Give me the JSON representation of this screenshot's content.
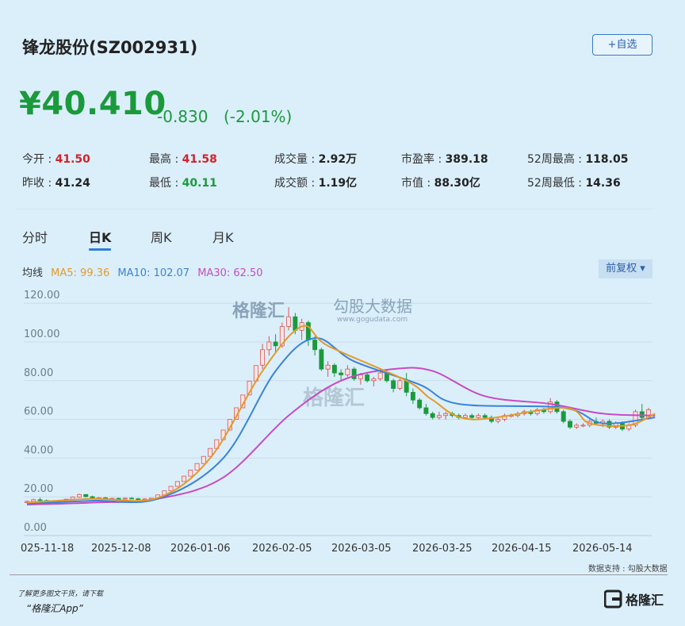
{
  "stock": {
    "title": "锋龙股份(SZ002931)",
    "fav_label": "+自选",
    "price": "¥40.410",
    "change": "-0.830",
    "change_pct": "(-2.01%)"
  },
  "stats": [
    {
      "label": "今开 : ",
      "value": "41.50",
      "color": "red"
    },
    {
      "label": "最高 : ",
      "value": "41.58",
      "color": "red"
    },
    {
      "label": "成交量 : ",
      "value": "2.92万",
      "color": "dark"
    },
    {
      "label": "市盈率 : ",
      "value": "389.18",
      "color": "dark"
    },
    {
      "label": "52周最高 : ",
      "value": "118.05",
      "color": "dark"
    },
    {
      "label": "昨收 : ",
      "value": "41.24",
      "color": "dark"
    },
    {
      "label": "最低 : ",
      "value": "40.11",
      "color": "green"
    },
    {
      "label": "成交额 : ",
      "value": "1.19亿",
      "color": "dark"
    },
    {
      "label": "市值 : ",
      "value": "88.30亿",
      "color": "dark"
    },
    {
      "label": "52周最低 : ",
      "value": "14.36",
      "color": "dark"
    }
  ],
  "tabs": [
    "分时",
    "日K",
    "周K",
    "月K"
  ],
  "active_tab": "日K",
  "ma": {
    "label": "均线",
    "ma5": "MA5: 99.36",
    "ma10": "MA10: 102.07",
    "ma30": "MA30: 62.50",
    "colors": {
      "ma5": "#e39a2a",
      "ma10": "#3b82d9",
      "ma30": "#c64bc2"
    }
  },
  "adjust_label": "前复权 ▾",
  "watermark": {
    "brand1": "格隆汇",
    "brand2": "勾股大数据",
    "url": "www.gogudata.com",
    "center": "格隆汇"
  },
  "chart_data": {
    "type": "candlestick",
    "y_ticks": [
      "120.00",
      "100.00",
      "80.00",
      "60.00",
      "40.00",
      "20.00",
      "0.00"
    ],
    "ylim": [
      0,
      125
    ],
    "x_ticks": [
      "025-11-18",
      "2025-12-08",
      "2026-01-06",
      "2026-02-05",
      "2026-03-05",
      "2026-03-25",
      "2026-04-15",
      "2026-05-14"
    ],
    "colors": {
      "up": "#d9534f",
      "down": "#1b9a3c"
    },
    "candles": [
      [
        17,
        18.2,
        16.6,
        17.6
      ],
      [
        17.6,
        19,
        17.2,
        18.5
      ],
      [
        18.5,
        19.6,
        17.8,
        18.1
      ],
      [
        18.1,
        18.6,
        17.2,
        17.5
      ],
      [
        17.5,
        18,
        16.8,
        17.2
      ],
      [
        17.2,
        18,
        16.9,
        17.7
      ],
      [
        17.7,
        19,
        17.4,
        18.8
      ],
      [
        18.8,
        20.2,
        18.4,
        19.9
      ],
      [
        19.9,
        21.6,
        19.5,
        21.2
      ],
      [
        21.2,
        21.4,
        19.6,
        20.1
      ],
      [
        20.1,
        20.6,
        19.1,
        19.4
      ],
      [
        19.4,
        20,
        18.8,
        19.5
      ],
      [
        19.5,
        20,
        18.6,
        18.9
      ],
      [
        18.9,
        19.5,
        18.4,
        19.2
      ],
      [
        19.2,
        19.6,
        18.7,
        18.9
      ],
      [
        18.9,
        19.6,
        18.5,
        19.3
      ],
      [
        19.3,
        19.8,
        18.8,
        19.0
      ],
      [
        19.0,
        19.4,
        18.4,
        18.7
      ],
      [
        18.7,
        19.2,
        18.3,
        18.9
      ],
      [
        18.9,
        19.5,
        18.6,
        19.3
      ],
      [
        19.3,
        21,
        19.3,
        21
      ],
      [
        21,
        23.1,
        21,
        23.1
      ],
      [
        23.1,
        25.4,
        23.1,
        25.4
      ],
      [
        25.4,
        27.9,
        25.4,
        27.9
      ],
      [
        27.9,
        30.7,
        27.9,
        30.7
      ],
      [
        30.7,
        33.8,
        30.7,
        33.8
      ],
      [
        33.8,
        37.2,
        33.8,
        37.2
      ],
      [
        37.2,
        40.9,
        37.2,
        40.9
      ],
      [
        40.9,
        45.0,
        40.9,
        45.0
      ],
      [
        45.0,
        49.5,
        45.0,
        49.5
      ],
      [
        49.5,
        54.5,
        49.5,
        54.5
      ],
      [
        54.5,
        60.0,
        54.5,
        60.0
      ],
      [
        60.0,
        66.0,
        60.0,
        66.0
      ],
      [
        66.0,
        72.6,
        66.0,
        72.6
      ],
      [
        72.6,
        79.8,
        72.6,
        79.8
      ],
      [
        79.8,
        87.8,
        79.8,
        87.8
      ],
      [
        88,
        99,
        86,
        96
      ],
      [
        96,
        103,
        93,
        100
      ],
      [
        100,
        104,
        95,
        98
      ],
      [
        98,
        110,
        97,
        108
      ],
      [
        108,
        118,
        106,
        113
      ],
      [
        113,
        115,
        104,
        106
      ],
      [
        106,
        112,
        101,
        110
      ],
      [
        110,
        111,
        98,
        101
      ],
      [
        101,
        103,
        93,
        96
      ],
      [
        96,
        97,
        85,
        86
      ],
      [
        86,
        90,
        82,
        88
      ],
      [
        88,
        89,
        82,
        84
      ],
      [
        84,
        86,
        80,
        83
      ],
      [
        83,
        88,
        82,
        86
      ],
      [
        86,
        87,
        80,
        81
      ],
      [
        81,
        84,
        78,
        83
      ],
      [
        83,
        84,
        79,
        80
      ],
      [
        80,
        82,
        77,
        81
      ],
      [
        81,
        86,
        80,
        84
      ],
      [
        84,
        85,
        79,
        80
      ],
      [
        80,
        81,
        74,
        76
      ],
      [
        76,
        82,
        75,
        80
      ],
      [
        80,
        84,
        72,
        74
      ],
      [
        74,
        76,
        68,
        70
      ],
      [
        70,
        71,
        65,
        66
      ],
      [
        66,
        68,
        62,
        63
      ],
      [
        63,
        64,
        60,
        61
      ],
      [
        61,
        64,
        60,
        62
      ],
      [
        62,
        64,
        60,
        63
      ],
      [
        63,
        64,
        61,
        62
      ],
      [
        62,
        63,
        60,
        61
      ],
      [
        61,
        63,
        60,
        62
      ],
      [
        62,
        63,
        60,
        61
      ],
      [
        61,
        63,
        60,
        62
      ],
      [
        62,
        63,
        60,
        61
      ],
      [
        61,
        62,
        58,
        59
      ],
      [
        59,
        61,
        58,
        60
      ],
      [
        60,
        63,
        59,
        62
      ],
      [
        62,
        63,
        61,
        62
      ],
      [
        62,
        64,
        61,
        63
      ],
      [
        63,
        65,
        62,
        64
      ],
      [
        64,
        65,
        62,
        63
      ],
      [
        63,
        66,
        62,
        65
      ],
      [
        65,
        66,
        63,
        64
      ],
      [
        64,
        71,
        63,
        69
      ],
      [
        69,
        70,
        63,
        64
      ],
      [
        64,
        65,
        58,
        59
      ],
      [
        59,
        60,
        55,
        56
      ],
      [
        56,
        58,
        55,
        57
      ],
      [
        57,
        58,
        56,
        57
      ],
      [
        57,
        60,
        56,
        59
      ],
      [
        59,
        61,
        57,
        58
      ],
      [
        58,
        60,
        56,
        59
      ],
      [
        59,
        60,
        55,
        56
      ],
      [
        56,
        59,
        55,
        58
      ],
      [
        58,
        59,
        54,
        55
      ],
      [
        55,
        58,
        54,
        57
      ],
      [
        57,
        65,
        56,
        64
      ],
      [
        64,
        68,
        60,
        61
      ],
      [
        61,
        66,
        60,
        65
      ]
    ],
    "ma5": [
      [
        0,
        17
      ],
      [
        10,
        19
      ],
      [
        20,
        19.5
      ],
      [
        28,
        40
      ],
      [
        36,
        85
      ],
      [
        42,
        108
      ],
      [
        46,
        98
      ],
      [
        58,
        80
      ],
      [
        62,
        70
      ],
      [
        68,
        60
      ],
      [
        82,
        66
      ],
      [
        86,
        58
      ],
      [
        92,
        57
      ],
      [
        96,
        63
      ]
    ],
    "ma10": [
      [
        0,
        16.5
      ],
      [
        10,
        18
      ],
      [
        20,
        19
      ],
      [
        30,
        40
      ],
      [
        38,
        85
      ],
      [
        44,
        102
      ],
      [
        50,
        90
      ],
      [
        60,
        78
      ],
      [
        66,
        68
      ],
      [
        82,
        66
      ],
      [
        88,
        58
      ],
      [
        96,
        61
      ]
    ],
    "ma30": [
      [
        0,
        16
      ],
      [
        10,
        17
      ],
      [
        20,
        19
      ],
      [
        30,
        30
      ],
      [
        40,
        62
      ],
      [
        48,
        80
      ],
      [
        56,
        86
      ],
      [
        62,
        85
      ],
      [
        70,
        72
      ],
      [
        80,
        68
      ],
      [
        88,
        63
      ],
      [
        96,
        62
      ]
    ]
  },
  "data_source": "数据支持 : 勾股大数据",
  "promo_line1": "了解更多图文干货，请下载",
  "promo_line2": "“格隆汇App”",
  "logo_text": "格隆汇"
}
